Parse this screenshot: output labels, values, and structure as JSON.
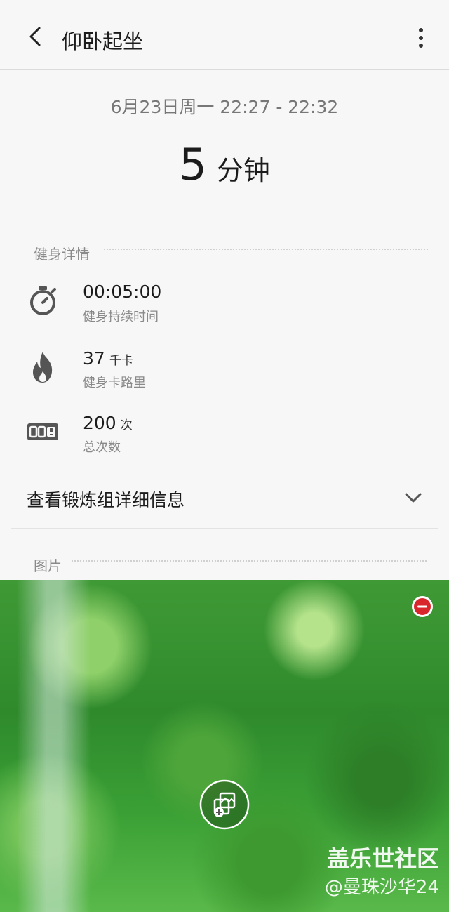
{
  "header": {
    "title": "仰卧起坐",
    "back_icon": "back-arrow-icon",
    "more_icon": "more-vert-icon"
  },
  "session": {
    "date_range": "6月23日周一 22:27 - 22:32",
    "duration_value": "5",
    "duration_unit": "分钟"
  },
  "details": {
    "heading": "健身详情",
    "items": [
      {
        "icon": "stopwatch-icon",
        "value": "00:05:00",
        "unit": "",
        "label": "健身持续时间"
      },
      {
        "icon": "flame-icon",
        "value": "37",
        "unit": "千卡",
        "label": "健身卡路里"
      },
      {
        "icon": "counter-icon",
        "value": "200",
        "unit": "次",
        "label": "总次数"
      }
    ]
  },
  "expand": {
    "label": "查看锻炼组详细信息",
    "icon": "chevron-down-icon"
  },
  "images": {
    "heading": "图片",
    "remove_icon": "remove-circle-icon",
    "add_icon": "add-image-icon"
  },
  "watermark": {
    "line1": "盖乐世社区",
    "line2": "@曼珠沙华24"
  },
  "colors": {
    "background": "#f7f7f7",
    "remove_red": "#d9262c",
    "text_primary": "#1c1c1c",
    "text_secondary": "#8a8a8a"
  }
}
